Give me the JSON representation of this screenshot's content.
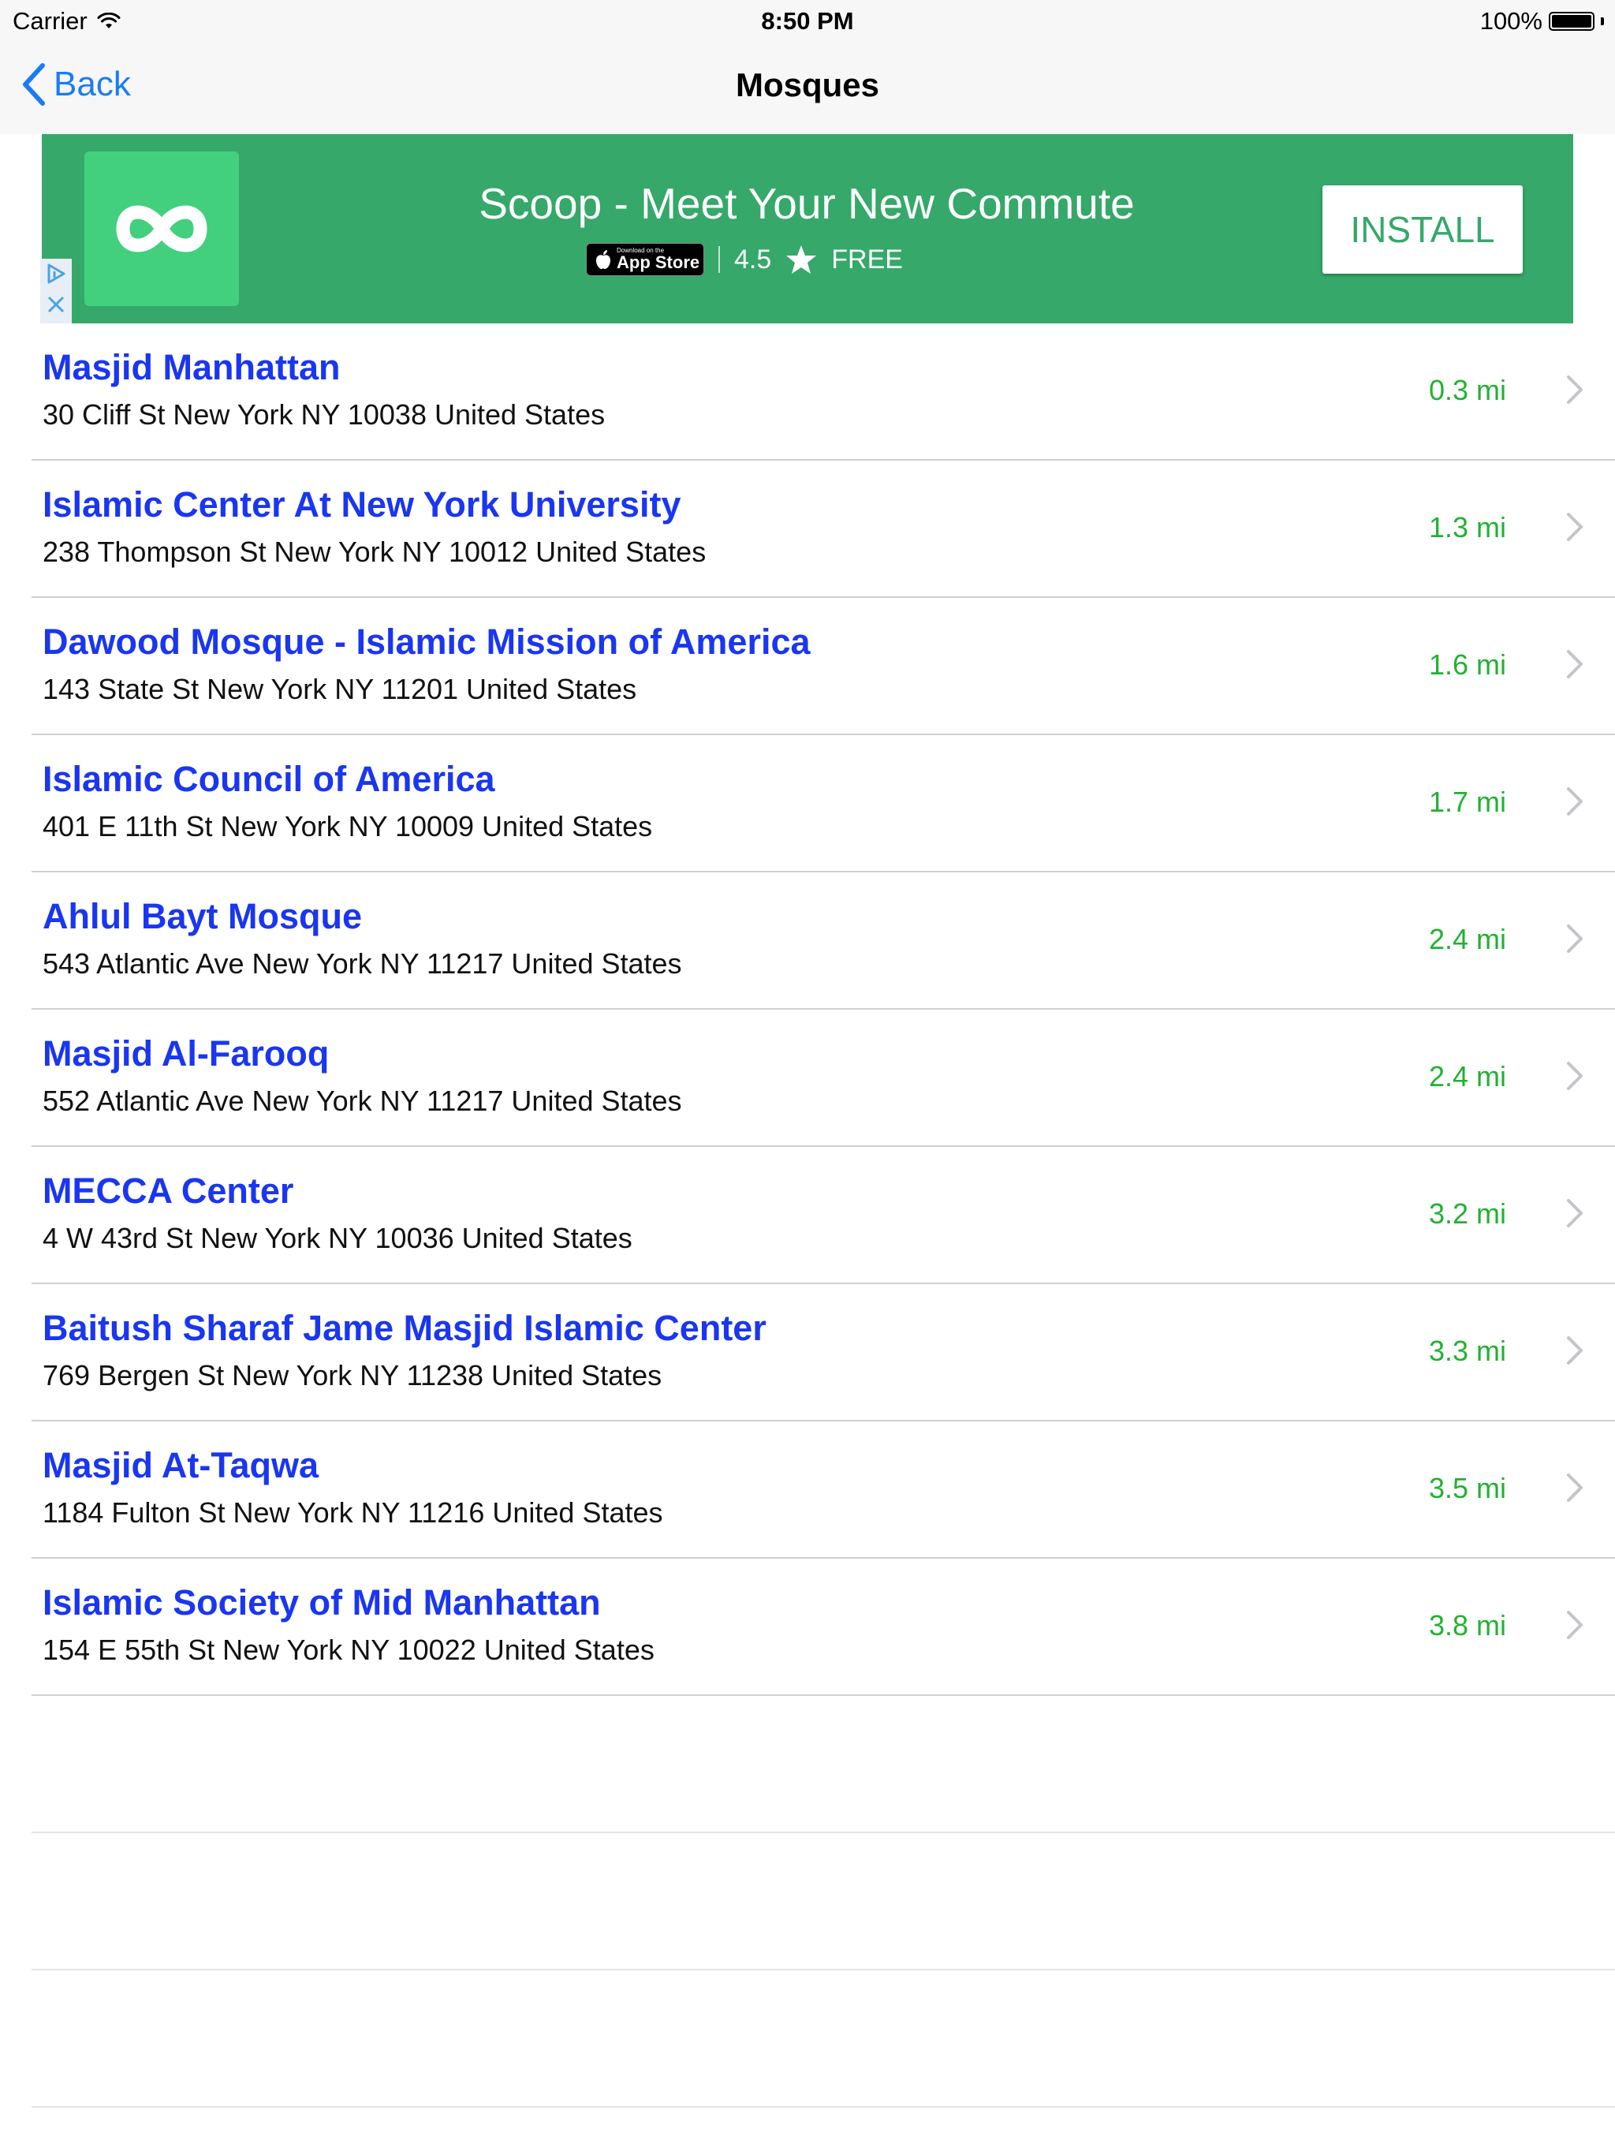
{
  "status_bar": {
    "carrier": "Carrier",
    "time": "8:50 PM",
    "battery": "100%",
    "battery_level_fraction": 1.0
  },
  "nav": {
    "back_label": "Back",
    "title": "Mosques"
  },
  "ad": {
    "headline": "Scoop - Meet Your New Commute",
    "badge_small": "Download on the",
    "badge_big": "App Store",
    "rating": "4.5",
    "price": "FREE",
    "cta": "INSTALL",
    "background_color": "#35a86a",
    "icon_color": "#42d07e"
  },
  "colors": {
    "title": "#1a36f0",
    "distance": "#22b133",
    "link": "#1a7cf5"
  },
  "mosques": [
    {
      "name": "Masjid Manhattan",
      "address": "30 Cliff St New York NY 10038 United States",
      "distance": "0.3 mi"
    },
    {
      "name": "Islamic Center At New York University",
      "address": "238 Thompson St New York NY 10012 United States",
      "distance": "1.3 mi"
    },
    {
      "name": "Dawood Mosque - Islamic Mission of America",
      "address": "143 State St New York NY 11201 United States",
      "distance": "1.6 mi"
    },
    {
      "name": "Islamic Council of America",
      "address": "401 E 11th St New York NY 10009 United States",
      "distance": "1.7 mi"
    },
    {
      "name": "Ahlul Bayt Mosque",
      "address": "543 Atlantic Ave New York NY 11217 United States",
      "distance": "2.4 mi"
    },
    {
      "name": "Masjid Al-Farooq",
      "address": "552 Atlantic Ave New York NY 11217 United States",
      "distance": "2.4 mi"
    },
    {
      "name": "MECCA Center",
      "address": "4 W 43rd St New York NY 10036 United States",
      "distance": "3.2 mi"
    },
    {
      "name": "Baitush Sharaf Jame Masjid Islamic Center",
      "address": "769 Bergen St New York NY 11238 United States",
      "distance": "3.3 mi"
    },
    {
      "name": "Masjid At-Taqwa",
      "address": "1184 Fulton St New York NY 11216 United States",
      "distance": "3.5 mi"
    },
    {
      "name": "Islamic Society of Mid Manhattan",
      "address": "154 E 55th St New York NY 10022 United States",
      "distance": "3.8 mi"
    }
  ]
}
